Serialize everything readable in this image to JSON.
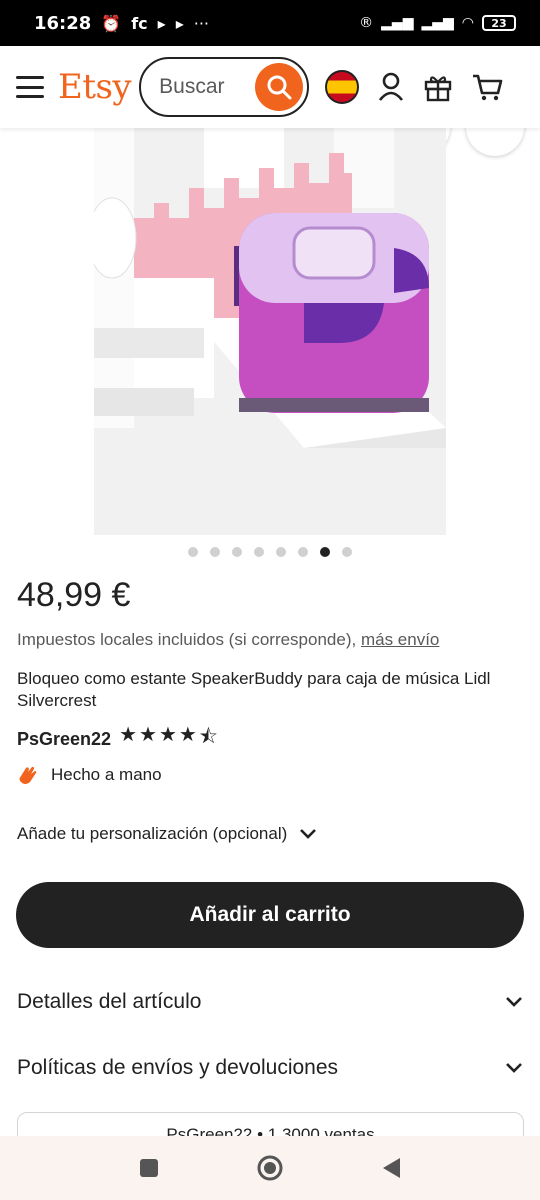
{
  "status_bar": {
    "time": "16:28",
    "carrier": "fc",
    "battery": "23"
  },
  "header": {
    "logo": "Etsy",
    "search_placeholder": "Buscar"
  },
  "gallery": {
    "image_count": 8,
    "active_index": 6
  },
  "product": {
    "price": "48,99 €",
    "tax_note": "Impuestos locales incluidos (si corresponde),",
    "shipping_link": "más envío",
    "title": "Bloqueo como estante SpeakerBuddy para caja de música Lidl Silvercrest",
    "shop_name": "PsGreen22",
    "rating": 4.5,
    "handmade_label": "Hecho a mano",
    "personalization_label": "Añade tu personalización (opcional)",
    "add_to_cart": "Añadir al carrito"
  },
  "accordions": [
    {
      "label": "Detalles del artículo"
    },
    {
      "label": "Políticas de envíos y devoluciones"
    }
  ],
  "shop_card": {
    "text": "PsGreen22 • 1.3000 ventas"
  },
  "colors": {
    "accent": "#f1641e",
    "dark": "#222222"
  }
}
